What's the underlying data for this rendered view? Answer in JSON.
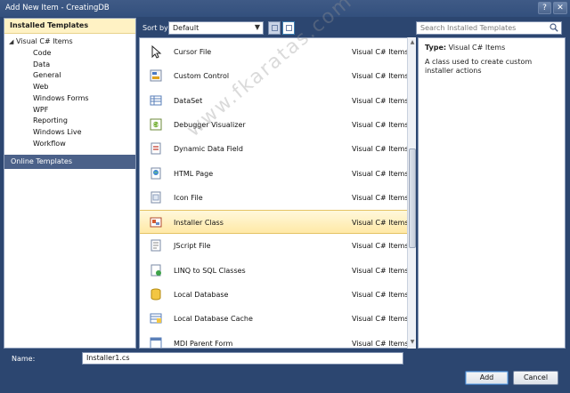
{
  "window": {
    "title": "Add New Item - CreatingDB",
    "help_label": "?",
    "close_label": "✕"
  },
  "left": {
    "header": "Installed Templates",
    "root": {
      "arrow": "◢",
      "label": "Visual C# Items"
    },
    "children": [
      "Code",
      "Data",
      "General",
      "Web",
      "Windows Forms",
      "WPF",
      "Reporting",
      "Windows Live",
      "Workflow"
    ],
    "online": "Online Templates"
  },
  "sort": {
    "label": "Sort by:",
    "value": "Default"
  },
  "search": {
    "placeholder": "Search Installed Templates"
  },
  "items": [
    {
      "name": "Cursor File",
      "lang": "Visual C# Items",
      "icon": "cursor-icon"
    },
    {
      "name": "Custom Control",
      "lang": "Visual C# Items",
      "icon": "custom-control-icon"
    },
    {
      "name": "DataSet",
      "lang": "Visual C# Items",
      "icon": "dataset-icon"
    },
    {
      "name": "Debugger Visualizer",
      "lang": "Visual C# Items",
      "icon": "debugger-visualizer-icon"
    },
    {
      "name": "Dynamic Data Field",
      "lang": "Visual C# Items",
      "icon": "dynamic-data-icon"
    },
    {
      "name": "HTML Page",
      "lang": "Visual C# Items",
      "icon": "html-page-icon"
    },
    {
      "name": "Icon File",
      "lang": "Visual C# Items",
      "icon": "icon-file-icon"
    },
    {
      "name": "Installer Class",
      "lang": "Visual C# Items",
      "icon": "installer-class-icon",
      "selected": true
    },
    {
      "name": "JScript File",
      "lang": "Visual C# Items",
      "icon": "jscript-icon"
    },
    {
      "name": "LINQ to SQL Classes",
      "lang": "Visual C# Items",
      "icon": "linq-icon"
    },
    {
      "name": "Local Database",
      "lang": "Visual C# Items",
      "icon": "database-icon"
    },
    {
      "name": "Local Database Cache",
      "lang": "Visual C# Items",
      "icon": "database-cache-icon"
    },
    {
      "name": "MDI Parent Form",
      "lang": "Visual C# Items",
      "icon": "mdi-form-icon"
    }
  ],
  "info": {
    "type_label": "Type:",
    "type_value": "Visual C# Items",
    "description": "A class used to create custom installer actions"
  },
  "footer": {
    "name_label": "Name:",
    "name_value": "Installer1.cs",
    "add_label": "Add",
    "cancel_label": "Cancel"
  },
  "watermark": "www.fkaratas.com"
}
